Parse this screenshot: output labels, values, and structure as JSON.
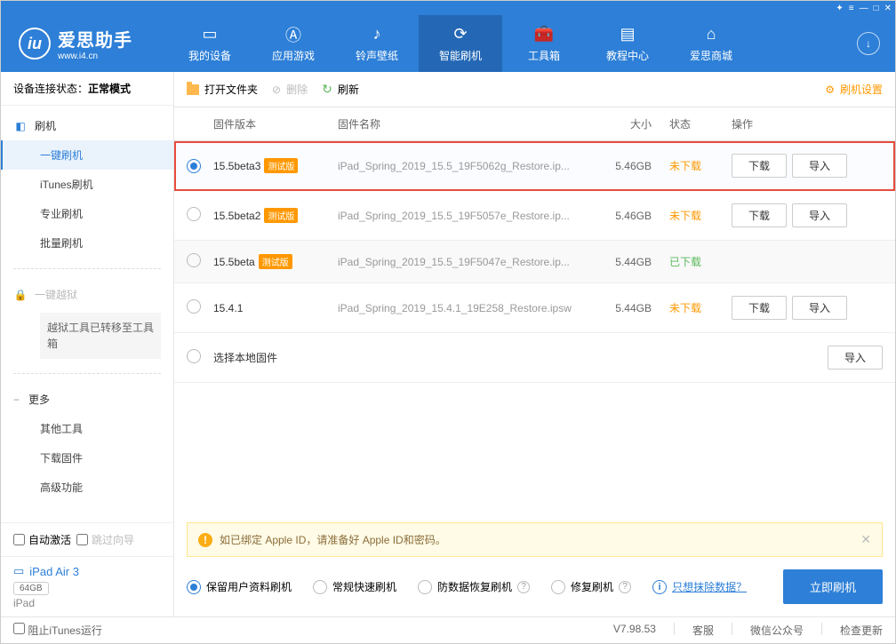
{
  "brand": {
    "name": "爱思助手",
    "domain": "www.i4.cn"
  },
  "nav": {
    "items": [
      {
        "label": "我的设备"
      },
      {
        "label": "应用游戏"
      },
      {
        "label": "铃声壁纸"
      },
      {
        "label": "智能刷机"
      },
      {
        "label": "工具箱"
      },
      {
        "label": "教程中心"
      },
      {
        "label": "爱思商城"
      }
    ]
  },
  "sidebar": {
    "conn_label": "设备连接状态：",
    "conn_value": "正常模式",
    "flash": {
      "title": "刷机",
      "items": [
        "一键刷机",
        "iTunes刷机",
        "专业刷机",
        "批量刷机"
      ]
    },
    "jailbreak": {
      "title": "一键越狱",
      "notice": "越狱工具已转移至工具箱"
    },
    "more": {
      "title": "更多",
      "items": [
        "其他工具",
        "下载固件",
        "高级功能"
      ]
    },
    "auto_activate": "自动激活",
    "skip_guide": "跳过向导",
    "device": {
      "name": "iPad Air 3",
      "capacity": "64GB",
      "type": "iPad"
    }
  },
  "toolbar": {
    "open_folder": "打开文件夹",
    "delete": "删除",
    "refresh": "刷新",
    "settings": "刷机设置"
  },
  "table": {
    "headers": {
      "version": "固件版本",
      "name": "固件名称",
      "size": "大小",
      "status": "状态",
      "action": "操作"
    },
    "rows": [
      {
        "version": "15.5beta3",
        "beta": "测试版",
        "name": "iPad_Spring_2019_15.5_19F5062g_Restore.ip...",
        "size": "5.46GB",
        "status": "未下载",
        "status_class": "pending",
        "selected": true,
        "show_actions": true
      },
      {
        "version": "15.5beta2",
        "beta": "测试版",
        "name": "iPad_Spring_2019_15.5_19F5057e_Restore.ip...",
        "size": "5.46GB",
        "status": "未下载",
        "status_class": "pending",
        "selected": false,
        "show_actions": true
      },
      {
        "version": "15.5beta",
        "beta": "测试版",
        "name": "iPad_Spring_2019_15.5_19F5047e_Restore.ip...",
        "size": "5.44GB",
        "status": "已下载",
        "status_class": "done",
        "selected": false,
        "show_actions": false
      },
      {
        "version": "15.4.1",
        "beta": "",
        "name": "iPad_Spring_2019_15.4.1_19E258_Restore.ipsw",
        "size": "5.44GB",
        "status": "未下载",
        "status_class": "pending",
        "selected": false,
        "show_actions": true
      }
    ],
    "local_firmware": "选择本地固件",
    "btn_download": "下载",
    "btn_import": "导入"
  },
  "alert": {
    "text": "如已绑定 Apple ID，请准备好 Apple ID和密码。"
  },
  "options": {
    "keep_data": "保留用户资料刷机",
    "normal": "常规快速刷机",
    "anti_recovery": "防数据恢复刷机",
    "repair": "修复刷机",
    "erase_link": "只想抹除数据？",
    "primary": "立即刷机"
  },
  "footer": {
    "block_itunes": "阻止iTunes运行",
    "version": "V7.98.53",
    "support": "客服",
    "wechat": "微信公众号",
    "check_update": "检查更新"
  }
}
